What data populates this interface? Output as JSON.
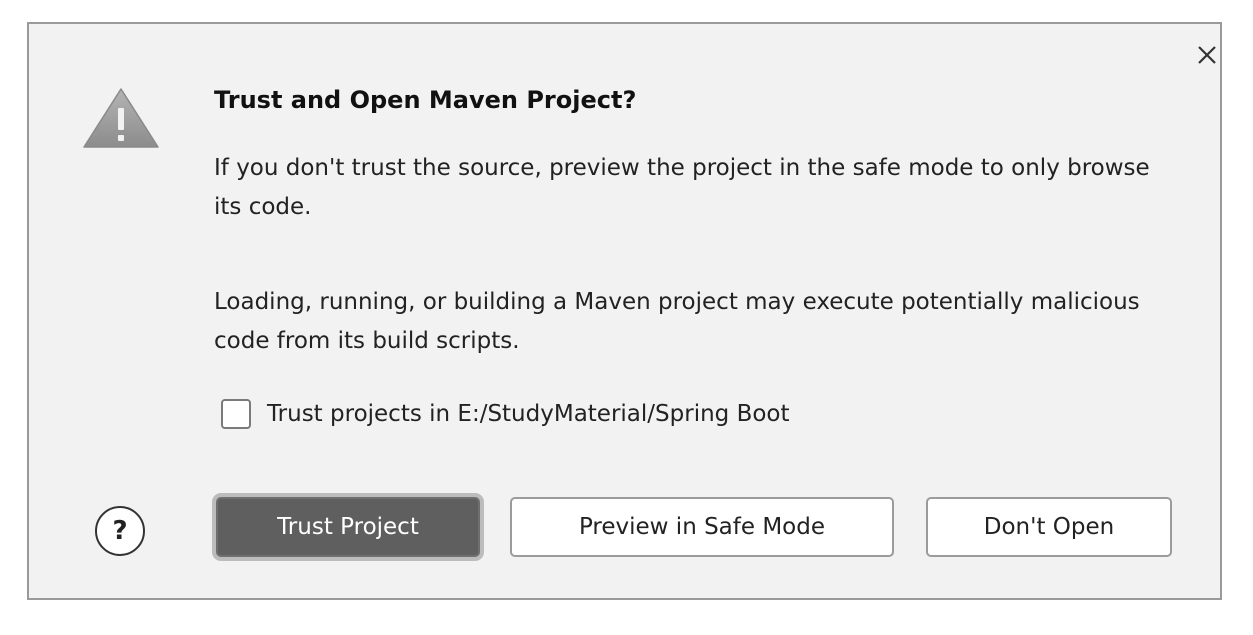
{
  "dialog": {
    "title": "Trust and Open Maven Project?",
    "paragraph1": "If you don't trust the source, preview the project in the safe mode to only browse its code.",
    "paragraph2": "Loading, running, or building a Maven project may execute potentially malicious code from its build scripts.",
    "checkbox": {
      "label": "Trust projects in E:/StudyMaterial/Spring Boot",
      "checked": false
    },
    "buttons": {
      "trust": "Trust Project",
      "preview": "Preview in Safe Mode",
      "dont_open": "Don't Open"
    },
    "help_glyph": "?",
    "icons": {
      "warning": "warning-icon",
      "close": "close-icon",
      "help": "help-icon"
    },
    "colors": {
      "background": "#f2f2f2",
      "primary_button": "#5f5f5f",
      "border": "#9a9a9a"
    }
  }
}
